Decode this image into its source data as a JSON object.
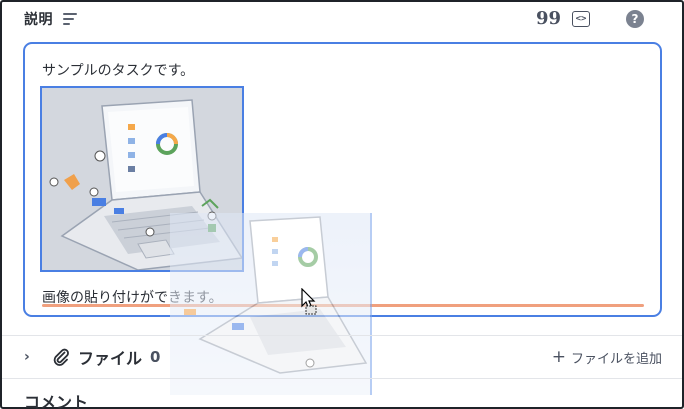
{
  "header": {
    "title": "説明",
    "icons": [
      "description-lines-icon",
      "quote-icon",
      "code-block-icon",
      "help-icon"
    ],
    "quote_glyph": "99",
    "code_glyph": "<>",
    "help_glyph": "?"
  },
  "editor": {
    "text_line1": "サンプルのタスクです。",
    "text_line2": "画像の貼り付けができます。",
    "image_label": "laptop-illustration"
  },
  "files": {
    "chevron": "›",
    "title": "ファイル",
    "count": "0",
    "add_label": "ファイルを追加",
    "add_plus": "+"
  },
  "comments": {
    "title": "コメント"
  },
  "colors": {
    "accent": "#4a7fe3",
    "underline": "#f0a07e",
    "text": "#2b2f36"
  }
}
